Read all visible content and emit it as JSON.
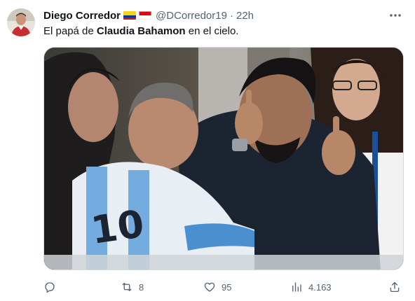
{
  "tweet": {
    "author_name": "Diego Corredor",
    "flags": [
      "colombia-flag",
      "indonesia-flag"
    ],
    "handle": "@DCorredor19",
    "separator": "·",
    "time": "22h",
    "text_before": "El papá de ",
    "text_bold": "Claudia Bahamon",
    "text_after": " en el cielo.",
    "media_icon": "photo-football-fans-in-stands"
  },
  "actions": {
    "reply": {
      "icon": "reply-icon",
      "count": ""
    },
    "retweet": {
      "icon": "retweet-icon",
      "count": "8"
    },
    "like": {
      "icon": "heart-icon",
      "count": "95"
    },
    "views": {
      "icon": "views-icon",
      "count": "4.163"
    },
    "share": {
      "icon": "share-icon"
    }
  },
  "colors": {
    "text_primary": "#0f1419",
    "text_secondary": "#536471",
    "border": "#cfd9de",
    "argentina_sky_blue": "#74acdf"
  }
}
